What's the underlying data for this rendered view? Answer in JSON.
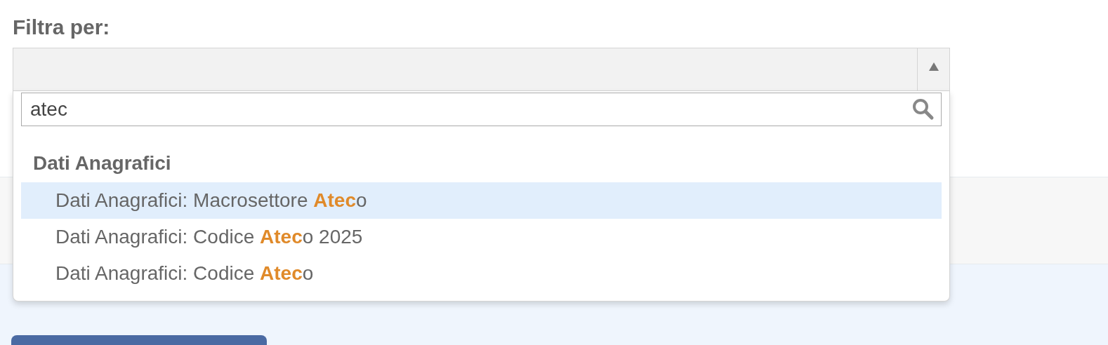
{
  "filter": {
    "label": "Filtra per:",
    "expanded": true,
    "search": {
      "value": "atec"
    },
    "groups": [
      {
        "label": "Dati Anagrafici",
        "options": [
          {
            "label": "Dati Anagrafici: Macrosettore **Atec**o",
            "selected": true
          },
          {
            "label": "Dati Anagrafici: Codice **Atec**o 2025",
            "selected": false
          },
          {
            "label": "Dati Anagrafici: Codice **Atec**o",
            "selected": false
          }
        ]
      }
    ]
  }
}
